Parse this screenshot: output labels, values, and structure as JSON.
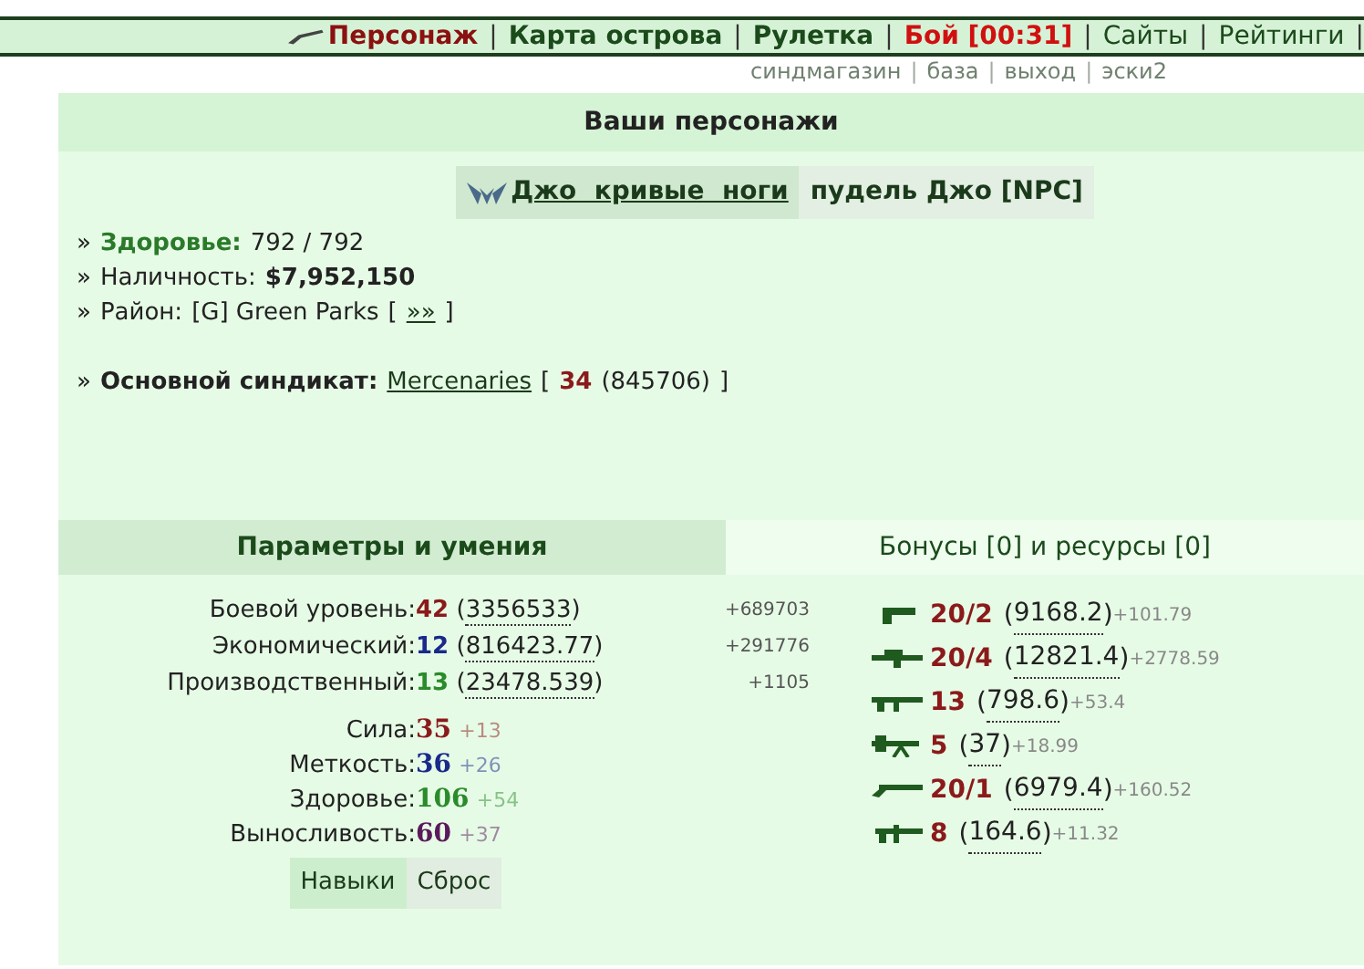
{
  "nav": {
    "items": [
      {
        "label": "Персонаж",
        "kind": "current"
      },
      {
        "label": "|",
        "kind": "separator"
      },
      {
        "label": "Карта острова",
        "kind": "main"
      },
      {
        "label": "|",
        "kind": "separator"
      },
      {
        "label": "Рулетка",
        "kind": "main"
      },
      {
        "label": "|",
        "kind": "separator"
      },
      {
        "label": "Бой [00:31]",
        "kind": "alert"
      },
      {
        "label": "|",
        "kind": "separator"
      },
      {
        "label": "Сайты",
        "kind": "plain"
      },
      {
        "label": "|",
        "kind": "separator"
      },
      {
        "label": "Рейтинги",
        "kind": "plain"
      },
      {
        "label": "|",
        "kind": "separator"
      }
    ],
    "sublinks": [
      {
        "label": "синдмагазин",
        "kind": "link"
      },
      {
        "label": "|",
        "kind": "separator"
      },
      {
        "label": "база",
        "kind": "link"
      },
      {
        "label": "|",
        "kind": "separator"
      },
      {
        "label": "выход",
        "kind": "link"
      },
      {
        "label": "|",
        "kind": "separator"
      },
      {
        "label": "эски2",
        "kind": "link"
      }
    ]
  },
  "panel": {
    "title": "Ваши персонажи",
    "characters": [
      {
        "name": "Джо  кривые  ноги",
        "selected": true
      },
      {
        "name": "пудель Джо [NPC]",
        "selected": false
      }
    ],
    "lines": [
      [
        {
          "text": "»",
          "kind": "bullet"
        },
        {
          "text": "Здоровье:",
          "kind": "label"
        },
        {
          "text": "792 / 792",
          "kind": "plain"
        }
      ],
      [
        {
          "text": "»",
          "kind": "bullet"
        },
        {
          "text": "Наличность:",
          "kind": "plain"
        },
        {
          "text": "$7,952,150",
          "kind": "bold"
        }
      ],
      [
        {
          "text": "»",
          "kind": "bullet"
        },
        {
          "text": "Район:",
          "kind": "plain"
        },
        {
          "text": "[G] Green Parks",
          "kind": "plain"
        },
        {
          "text": "[",
          "kind": "plain"
        },
        {
          "text": "»»",
          "kind": "link"
        },
        {
          "text": "]",
          "kind": "plain"
        }
      ],
      [
        {
          "text": "»",
          "kind": "bullet"
        },
        {
          "text": "Основной синдикат:",
          "kind": "bold"
        },
        {
          "text": "Mercenaries",
          "kind": "link"
        },
        {
          "text": "[",
          "kind": "plain"
        },
        {
          "text": "34",
          "kind": "level"
        },
        {
          "text": "(845706)",
          "kind": "plain"
        },
        {
          "text": "]",
          "kind": "plain"
        }
      ]
    ]
  },
  "sections": [
    {
      "label": "Параметры и умения",
      "selected": true
    },
    {
      "label": "Бонусы [0] и ресурсы [0]",
      "selected": false
    }
  ],
  "levels": [
    {
      "label": "Боевой уровень:",
      "value": "42",
      "open": "(",
      "exp": "3356533",
      "close": ")",
      "gain": "+689703",
      "color": "#8b1a1a"
    },
    {
      "label": "Экономический:",
      "value": "12",
      "open": "(",
      "exp": "816423.77",
      "close": ")",
      "gain": "+291776",
      "color": "#1a2a8b"
    },
    {
      "label": "Производственный:",
      "value": "13",
      "open": "(",
      "exp": "23478.539",
      "close": ")",
      "gain": "+1105",
      "color": "#2a8b2a"
    }
  ],
  "stats": [
    {
      "label": "Сила:",
      "value": "35",
      "bonus": "+13",
      "color": "#8b1a1a"
    },
    {
      "label": "Меткость:",
      "value": "36",
      "bonus": "+26",
      "color": "#1a2a8b"
    },
    {
      "label": "Здоровье:",
      "value": "106",
      "bonus": "+54",
      "color": "#2a8b2a"
    },
    {
      "label": "Выносливость:",
      "value": "60",
      "bonus": "+37",
      "color": "#5a1a5a"
    }
  ],
  "buttons": [
    {
      "label": "Навыки",
      "selected": true
    },
    {
      "label": "Сброс",
      "selected": false
    }
  ],
  "weapons": [
    {
      "kind": "pistol",
      "level": "20/2",
      "open": "(",
      "exp": "9168.2",
      "close": ")",
      "gain": "+101.79"
    },
    {
      "kind": "launcher",
      "level": "20/4",
      "open": "(",
      "exp": "12821.4",
      "close": ")",
      "gain": "+2778.59"
    },
    {
      "kind": "rifle",
      "level": "13",
      "open": "(",
      "exp": "798.6",
      "close": ")",
      "gain": "+53.4"
    },
    {
      "kind": "bipod",
      "level": "5",
      "open": "(",
      "exp": "37",
      "close": ")",
      "gain": "+18.99"
    },
    {
      "kind": "shotgun",
      "level": "20/1",
      "open": "(",
      "exp": "6979.4",
      "close": ")",
      "gain": "+160.52"
    },
    {
      "kind": "smg",
      "level": "8",
      "open": "(",
      "exp": "164.6",
      "close": ")",
      "gain": "+11.32"
    }
  ]
}
